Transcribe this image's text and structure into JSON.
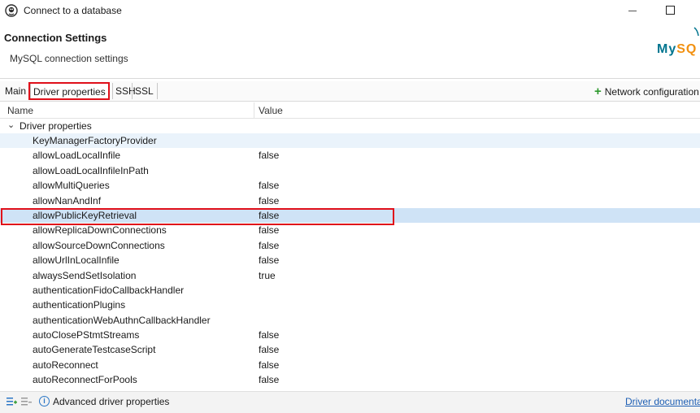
{
  "window": {
    "title": "Connect to a database"
  },
  "header": {
    "title": "Connection Settings",
    "subtitle": "MySQL connection settings",
    "logo_text": "MySQL"
  },
  "tabs": [
    {
      "label": "Main",
      "active": false
    },
    {
      "label": "Driver properties",
      "active": true
    },
    {
      "label": "SSH",
      "active": false
    },
    {
      "label": "SSL",
      "active": false
    }
  ],
  "network_config_label": "Network configuration",
  "table": {
    "columns": [
      "Name",
      "Value"
    ],
    "group_label": "Driver properties",
    "rows": [
      {
        "name": "KeyManagerFactoryProvider",
        "value": ""
      },
      {
        "name": "allowLoadLocalInfile",
        "value": "false"
      },
      {
        "name": "allowLoadLocalInfileInPath",
        "value": ""
      },
      {
        "name": "allowMultiQueries",
        "value": "false"
      },
      {
        "name": "allowNanAndInf",
        "value": "false"
      },
      {
        "name": "allowPublicKeyRetrieval",
        "value": "false"
      },
      {
        "name": "allowReplicaDownConnections",
        "value": "false"
      },
      {
        "name": "allowSourceDownConnections",
        "value": "false"
      },
      {
        "name": "allowUrlInLocalInfile",
        "value": "false"
      },
      {
        "name": "alwaysSendSetIsolation",
        "value": "true"
      },
      {
        "name": "authenticationFidoCallbackHandler",
        "value": ""
      },
      {
        "name": "authenticationPlugins",
        "value": ""
      },
      {
        "name": "authenticationWebAuthnCallbackHandler",
        "value": ""
      },
      {
        "name": "autoClosePStmtStreams",
        "value": "false"
      },
      {
        "name": "autoGenerateTestcaseScript",
        "value": "false"
      },
      {
        "name": "autoReconnect",
        "value": "false"
      },
      {
        "name": "autoReconnectForPools",
        "value": "false"
      }
    ]
  },
  "footer": {
    "advanced_label": "Advanced driver properties",
    "doc_link": "Driver documentation"
  },
  "icons": [
    "app-icon",
    "minimize-icon",
    "maximize-icon",
    "plus-icon",
    "chevron-down-icon",
    "expand-all-icon",
    "collapse-all-icon",
    "info-icon"
  ],
  "colors": {
    "highlight_box": "#e0101a",
    "selected_row": "#cfe3f6",
    "hover_row": "#eaf3fb",
    "link": "#1e5fb4",
    "plus": "#2e9a2e"
  }
}
